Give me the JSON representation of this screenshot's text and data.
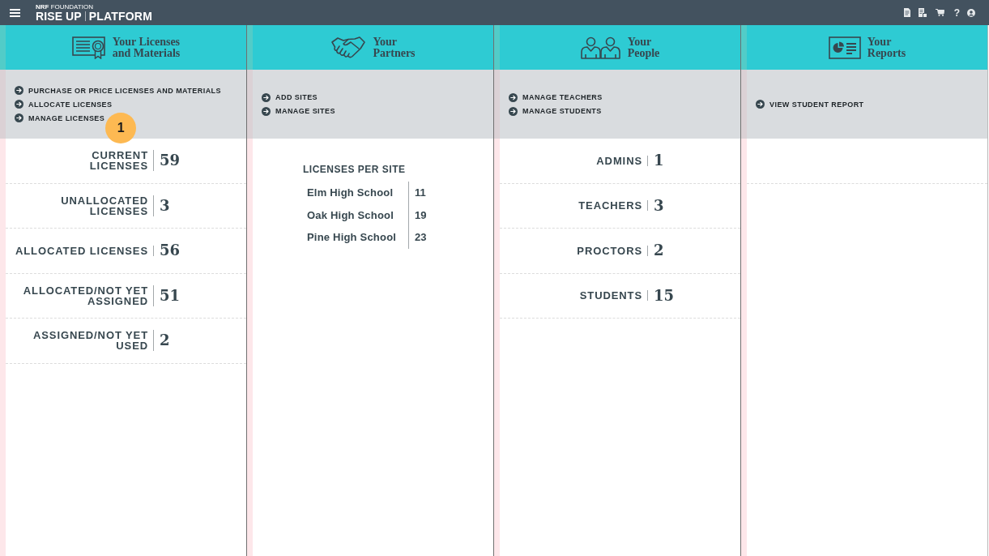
{
  "top_bar": {
    "brand": {
      "overline": "**NRF** FOUNDATION",
      "name": "RISE UP",
      "product": "PLATFORM"
    },
    "actions": [
      {
        "kind": "document"
      },
      {
        "kind": "document-list"
      },
      {
        "kind": "cart"
      },
      {
        "kind": "help",
        "label": "?"
      },
      {
        "kind": "user"
      }
    ]
  },
  "columns": [
    {
      "kind": "licenses",
      "title": "Your Licenses\nand Materials",
      "links": [
        {
          "label": "PURCHASE OR PRICE LICENSES AND MATERIALS"
        },
        {
          "label": "ALLOCATE LICENSES"
        },
        {
          "label": "MANAGE LICENSES",
          "callout": "1"
        }
      ],
      "stats": [
        {
          "label": "CURRENT\nLICENSES",
          "value": "59"
        },
        {
          "label": "UNALLOCATED\nLICENSES",
          "value": "3"
        },
        {
          "label": "ALLOCATED LICENSES",
          "value": "56"
        },
        {
          "label": "ALLOCATED/NOT YET\nASSIGNED",
          "value": "51"
        },
        {
          "label": "ASSIGNED/NOT YET\nUSED",
          "value": "2"
        }
      ]
    },
    {
      "kind": "partners",
      "title": "Your\nPartners",
      "links": [
        {
          "label": "ADD SITES"
        },
        {
          "label": "MANAGE SITES"
        }
      ],
      "site_table": {
        "heading": "LICENSES PER SITE",
        "rows": [
          {
            "site": "Elm High School",
            "count": "11"
          },
          {
            "site": "Oak High School",
            "count": "19"
          },
          {
            "site": "Pine High School",
            "count": "23"
          }
        ]
      }
    },
    {
      "kind": "people",
      "title": "Your\nPeople",
      "links": [
        {
          "label": "MANAGE TEACHERS"
        },
        {
          "label": "MANAGE STUDENTS"
        }
      ],
      "stats": [
        {
          "label": "ADMINS",
          "value": "1"
        },
        {
          "label": "TEACHERS",
          "value": "3"
        },
        {
          "label": "PROCTORS",
          "value": "2"
        },
        {
          "label": "STUDENTS",
          "value": "15"
        }
      ]
    },
    {
      "kind": "reports",
      "title": "Your\nReports",
      "links": [
        {
          "label": "VIEW STUDENT REPORT"
        }
      ]
    }
  ]
}
